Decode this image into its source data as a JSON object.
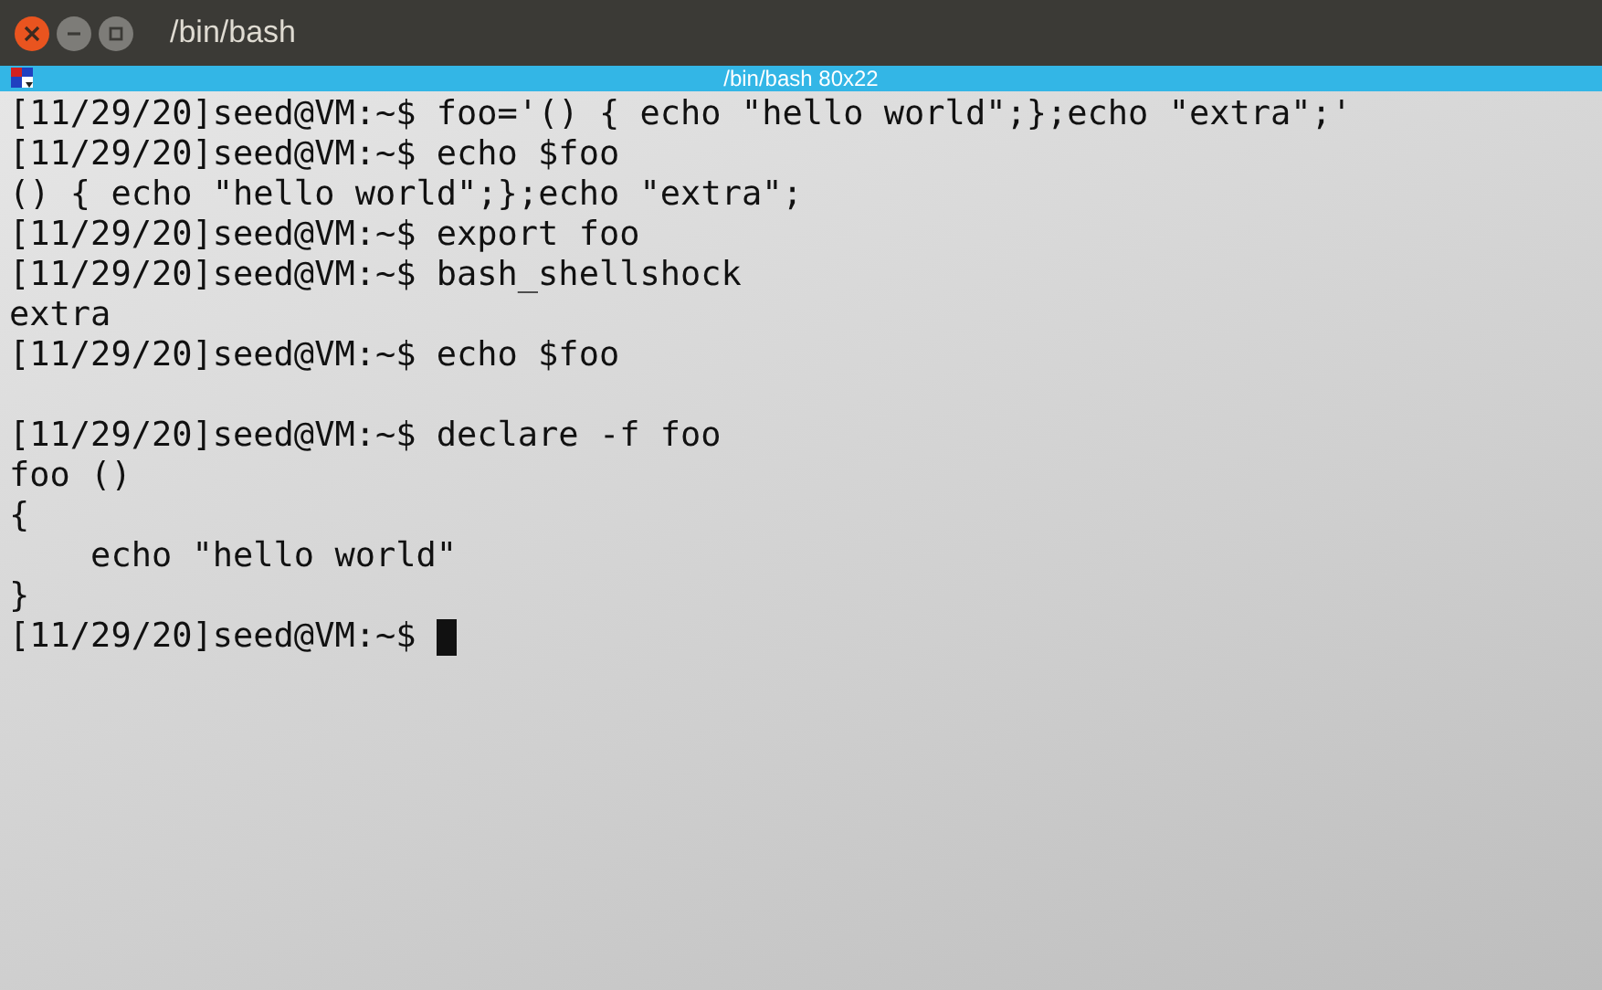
{
  "window": {
    "title": "/bin/bash"
  },
  "terminal": {
    "title": "/bin/bash 80x22",
    "lines": [
      {
        "kind": "prompt",
        "prompt": "[11/29/20]seed@VM:~$",
        "command": "foo='() { echo \"hello world\";};echo \"extra\";'"
      },
      {
        "kind": "prompt",
        "prompt": "[11/29/20]seed@VM:~$",
        "command": "echo $foo"
      },
      {
        "kind": "output",
        "text": "() { echo \"hello world\";};echo \"extra\";"
      },
      {
        "kind": "prompt",
        "prompt": "[11/29/20]seed@VM:~$",
        "command": "export foo"
      },
      {
        "kind": "prompt",
        "prompt": "[11/29/20]seed@VM:~$",
        "command": "bash_shellshock"
      },
      {
        "kind": "output",
        "text": "extra"
      },
      {
        "kind": "prompt",
        "prompt": "[11/29/20]seed@VM:~$",
        "command": "echo $foo"
      },
      {
        "kind": "blank"
      },
      {
        "kind": "prompt",
        "prompt": "[11/29/20]seed@VM:~$",
        "command": "declare -f foo"
      },
      {
        "kind": "output",
        "text": "foo ()"
      },
      {
        "kind": "output",
        "text": "{"
      },
      {
        "kind": "output",
        "text": "    echo \"hello world\""
      },
      {
        "kind": "output",
        "text": "}"
      },
      {
        "kind": "prompt",
        "prompt": "[11/29/20]seed@VM:~$",
        "cursor": true
      }
    ]
  }
}
